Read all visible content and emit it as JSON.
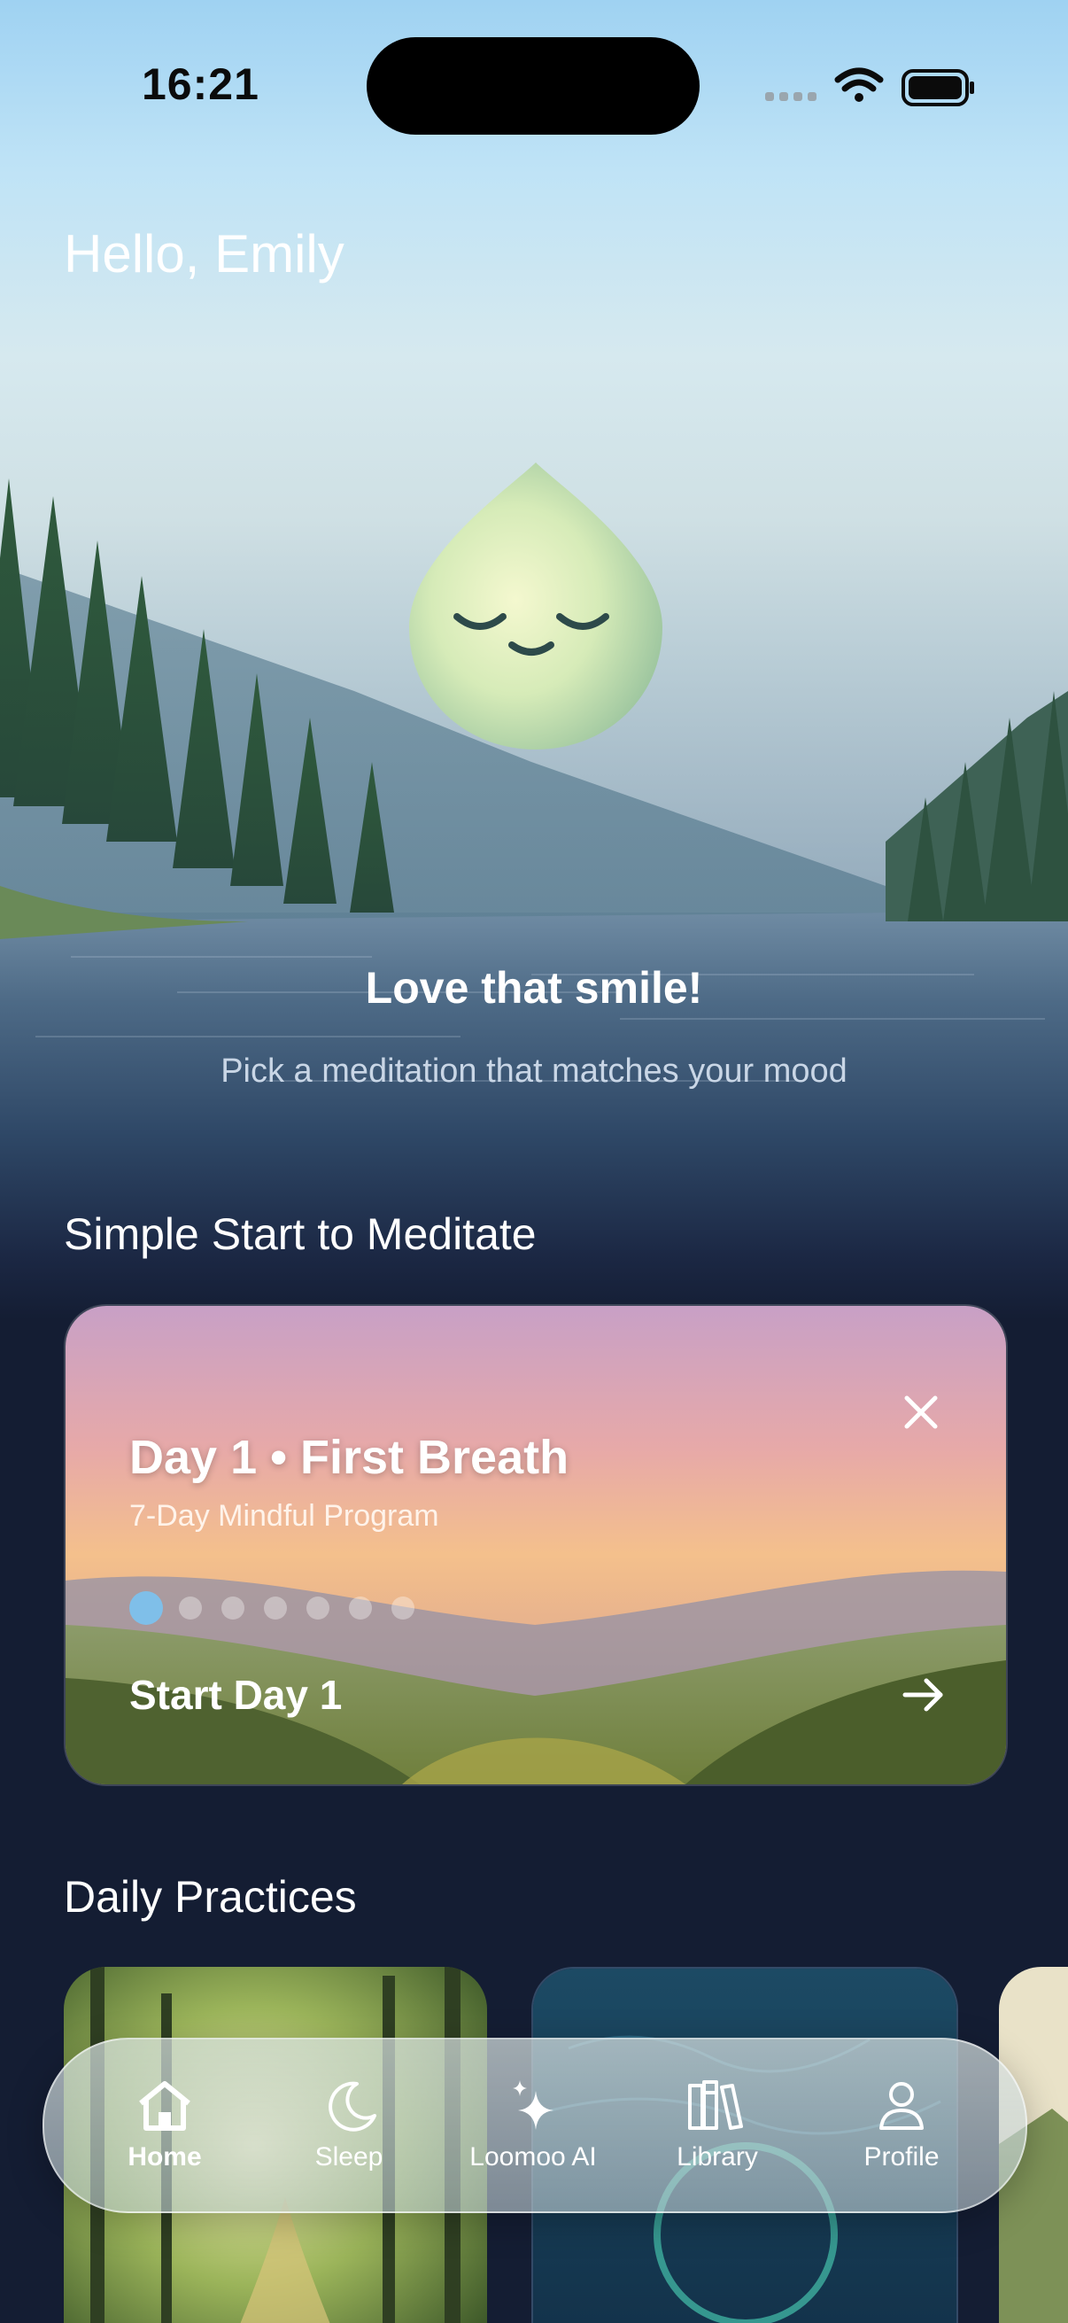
{
  "status_bar": {
    "time": "16:21"
  },
  "header": {
    "greeting": "Hello, Emily"
  },
  "hero": {
    "title": "Love that smile!",
    "subtitle": "Pick a meditation that matches your mood"
  },
  "sections": {
    "simple_start": "Simple Start to Meditate",
    "daily_practices": "Daily Practices"
  },
  "program_card": {
    "title": "Day 1 • First Breath",
    "subtitle": "7-Day Mindful Program",
    "cta": "Start Day 1",
    "days_total": 7,
    "current_day": 1
  },
  "tab_bar": {
    "items": [
      {
        "label": "Home",
        "icon": "home-icon",
        "active": true
      },
      {
        "label": "Sleep",
        "icon": "moon-icon",
        "active": false
      },
      {
        "label": "Loomoo AI",
        "icon": "sparkles-icon",
        "active": false
      },
      {
        "label": "Library",
        "icon": "books-icon",
        "active": false
      },
      {
        "label": "Profile",
        "icon": "person-icon",
        "active": false
      }
    ]
  },
  "colors": {
    "accent": "#7fbfe9",
    "background": "#141d33"
  }
}
